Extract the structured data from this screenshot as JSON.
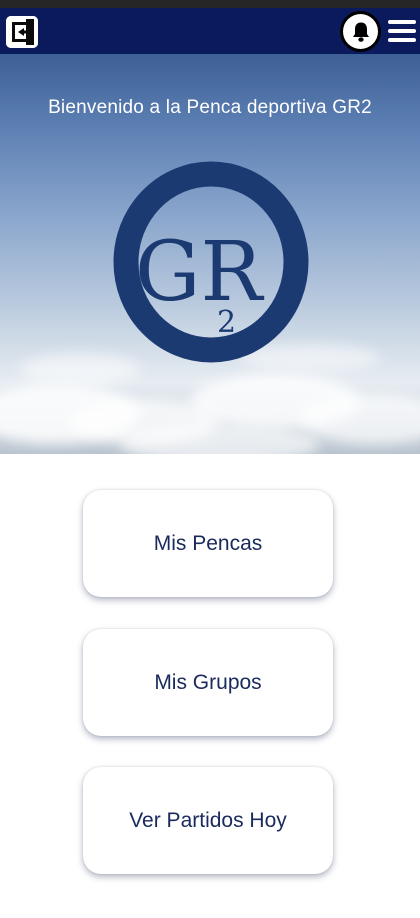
{
  "navbar": {
    "logout_icon": "logout-icon",
    "notifications_icon": "bell-icon",
    "menu_icon": "hamburger-menu-icon",
    "background_color": "#0a1a5c"
  },
  "hero": {
    "title": "Bienvenido a la Penca deportiva GR2",
    "logo": {
      "main_text": "GR",
      "subscript": "2",
      "color": "#1b3a72"
    }
  },
  "menu": {
    "items": [
      {
        "label": "Mis Pencas"
      },
      {
        "label": "Mis Grupos"
      },
      {
        "label": "Ver Partidos Hoy"
      }
    ]
  }
}
